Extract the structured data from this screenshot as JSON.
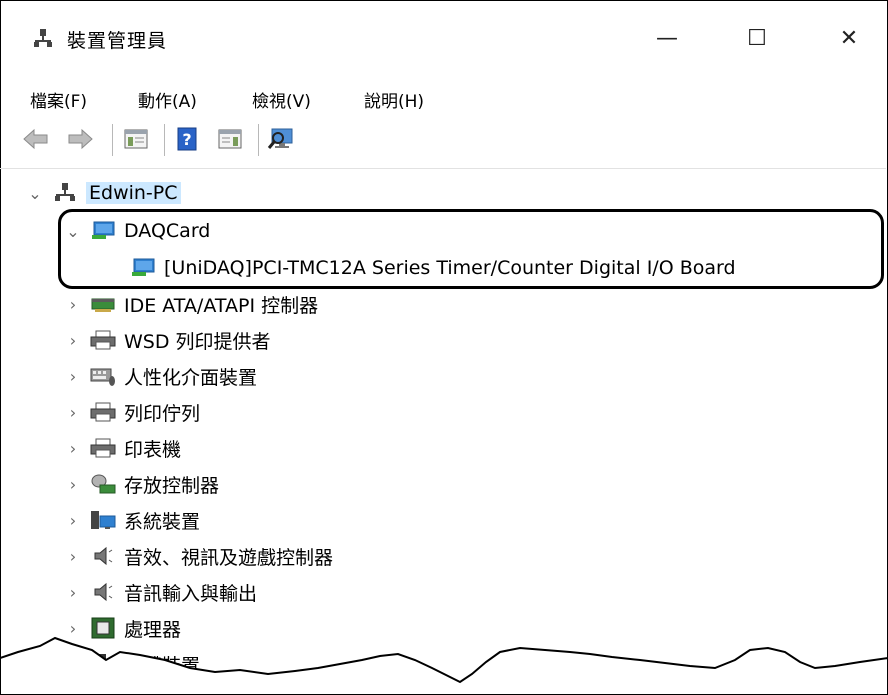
{
  "window": {
    "title": "裝置管理員",
    "controls": {
      "minimize": "—",
      "maximize": "☐",
      "close": "✕"
    }
  },
  "menu": [
    {
      "label": "檔案",
      "key": "(F)",
      "key_letter": "F"
    },
    {
      "label": "動作",
      "key": "(A)",
      "key_letter": "A"
    },
    {
      "label": "檢視",
      "key": "(V)",
      "key_letter": "V"
    },
    {
      "label": "說明",
      "key": "(H)",
      "key_letter": "H"
    }
  ],
  "tree": {
    "root": "Edwin-PC",
    "daqcard": {
      "label": "DAQCard",
      "child": "[UniDAQ]PCI-TMC12A Series Timer/Counter Digital I/O Board"
    },
    "categories": [
      {
        "label": "IDE ATA/ATAPI 控制器",
        "icon": "ide-controller-icon"
      },
      {
        "label": "WSD 列印提供者",
        "icon": "printer-icon"
      },
      {
        "label": "人性化介面裝置",
        "icon": "hid-keyboard-icon"
      },
      {
        "label": "列印佇列",
        "icon": "printer-icon"
      },
      {
        "label": "印表機",
        "icon": "printer-icon"
      },
      {
        "label": "存放控制器",
        "icon": "storage-controller-icon"
      },
      {
        "label": "系統裝置",
        "icon": "system-devices-icon"
      },
      {
        "label": "音效、視訊及遊戲控制器",
        "icon": "speaker-icon"
      },
      {
        "label": "音訊輸入與輸出",
        "icon": "speaker-icon"
      },
      {
        "label": "處理器",
        "icon": "processor-icon"
      },
      {
        "label": "軟體裝置",
        "icon": "software-device-icon"
      }
    ]
  }
}
